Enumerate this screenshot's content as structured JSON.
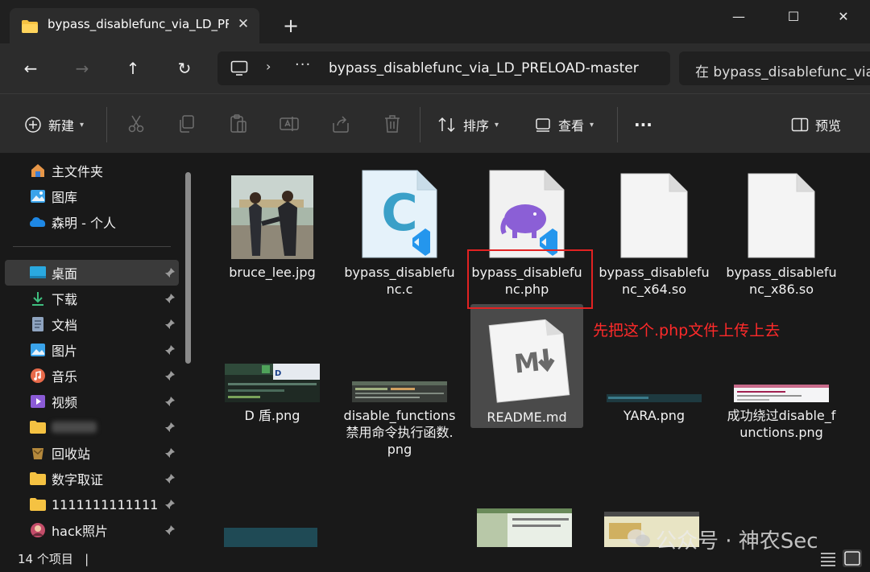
{
  "tab": {
    "title": "bypass_disablefunc_via_LD_PR",
    "close": "✕"
  },
  "new_tab": "+",
  "window_controls": {
    "minimize": "—",
    "maximize": "☐",
    "close": "✕"
  },
  "nav_buttons": {
    "back": "←",
    "forward": "→",
    "up": "↑",
    "refresh": "↻"
  },
  "address": {
    "chevron": "›",
    "ellipsis": "···",
    "path": "bypass_disablefunc_via_LD_PRELOAD-master"
  },
  "search": {
    "placeholder": "在 bypass_disablefunc_via_"
  },
  "toolbar": {
    "new_label": "新建",
    "sort_label": "排序",
    "view_label": "查看",
    "more": "···",
    "preview_label": "预览"
  },
  "sidebar": {
    "top_items": [
      {
        "label": "主文件夹",
        "icon": "home-icon"
      },
      {
        "label": "图库",
        "icon": "gallery-icon"
      },
      {
        "label": "森明 - 个人",
        "icon": "onedrive-cloud-icon"
      }
    ],
    "pinned_items": [
      {
        "label": "桌面",
        "icon": "desktop-icon"
      },
      {
        "label": "下载",
        "icon": "download-icon"
      },
      {
        "label": "文档",
        "icon": "document-icon"
      },
      {
        "label": "图片",
        "icon": "pictures-icon"
      },
      {
        "label": "音乐",
        "icon": "music-icon"
      },
      {
        "label": "视频",
        "icon": "video-icon"
      },
      {
        "label": "",
        "icon": "folder-icon"
      },
      {
        "label": "回收站",
        "icon": "recycle-bin-icon"
      },
      {
        "label": "数字取证",
        "icon": "folder-icon"
      },
      {
        "label": "1111111111111",
        "icon": "folder-icon"
      },
      {
        "label": "hack照片",
        "icon": "photo-folder-icon"
      }
    ]
  },
  "files": [
    {
      "name": "bruce_lee.jpg",
      "kind": "photo"
    },
    {
      "name": "bypass_disablefunc.c",
      "kind": "c-source"
    },
    {
      "name": "bypass_disablefunc.php",
      "kind": "php-source"
    },
    {
      "name": "bypass_disablefunc_x64.so",
      "kind": "blank-file"
    },
    {
      "name": "bypass_disablefunc_x86.so",
      "kind": "blank-file"
    },
    {
      "name": "D 盾.png",
      "kind": "screenshot"
    },
    {
      "name": "disable_functions 禁用命令执行函数.png",
      "kind": "screenshot"
    },
    {
      "name": "README.md",
      "kind": "markdown"
    },
    {
      "name": "YARA.png",
      "kind": "screenshot"
    },
    {
      "name": "成功绕过disable_functions.png",
      "kind": "screenshot"
    }
  ],
  "annotation": "先把这个.php文件上传上去",
  "status": {
    "count": "14 个项目",
    "cursor": "|"
  },
  "watermark": "公众号 · 神农Sec",
  "colors": {
    "annotation_red": "#ff2a2a",
    "selection_box": "#e22222",
    "folder_yellow": "#f5c242",
    "vscode_blue": "#2496ed",
    "php_purple": "#8b5fd6",
    "c_teal": "#3aa0c8"
  }
}
